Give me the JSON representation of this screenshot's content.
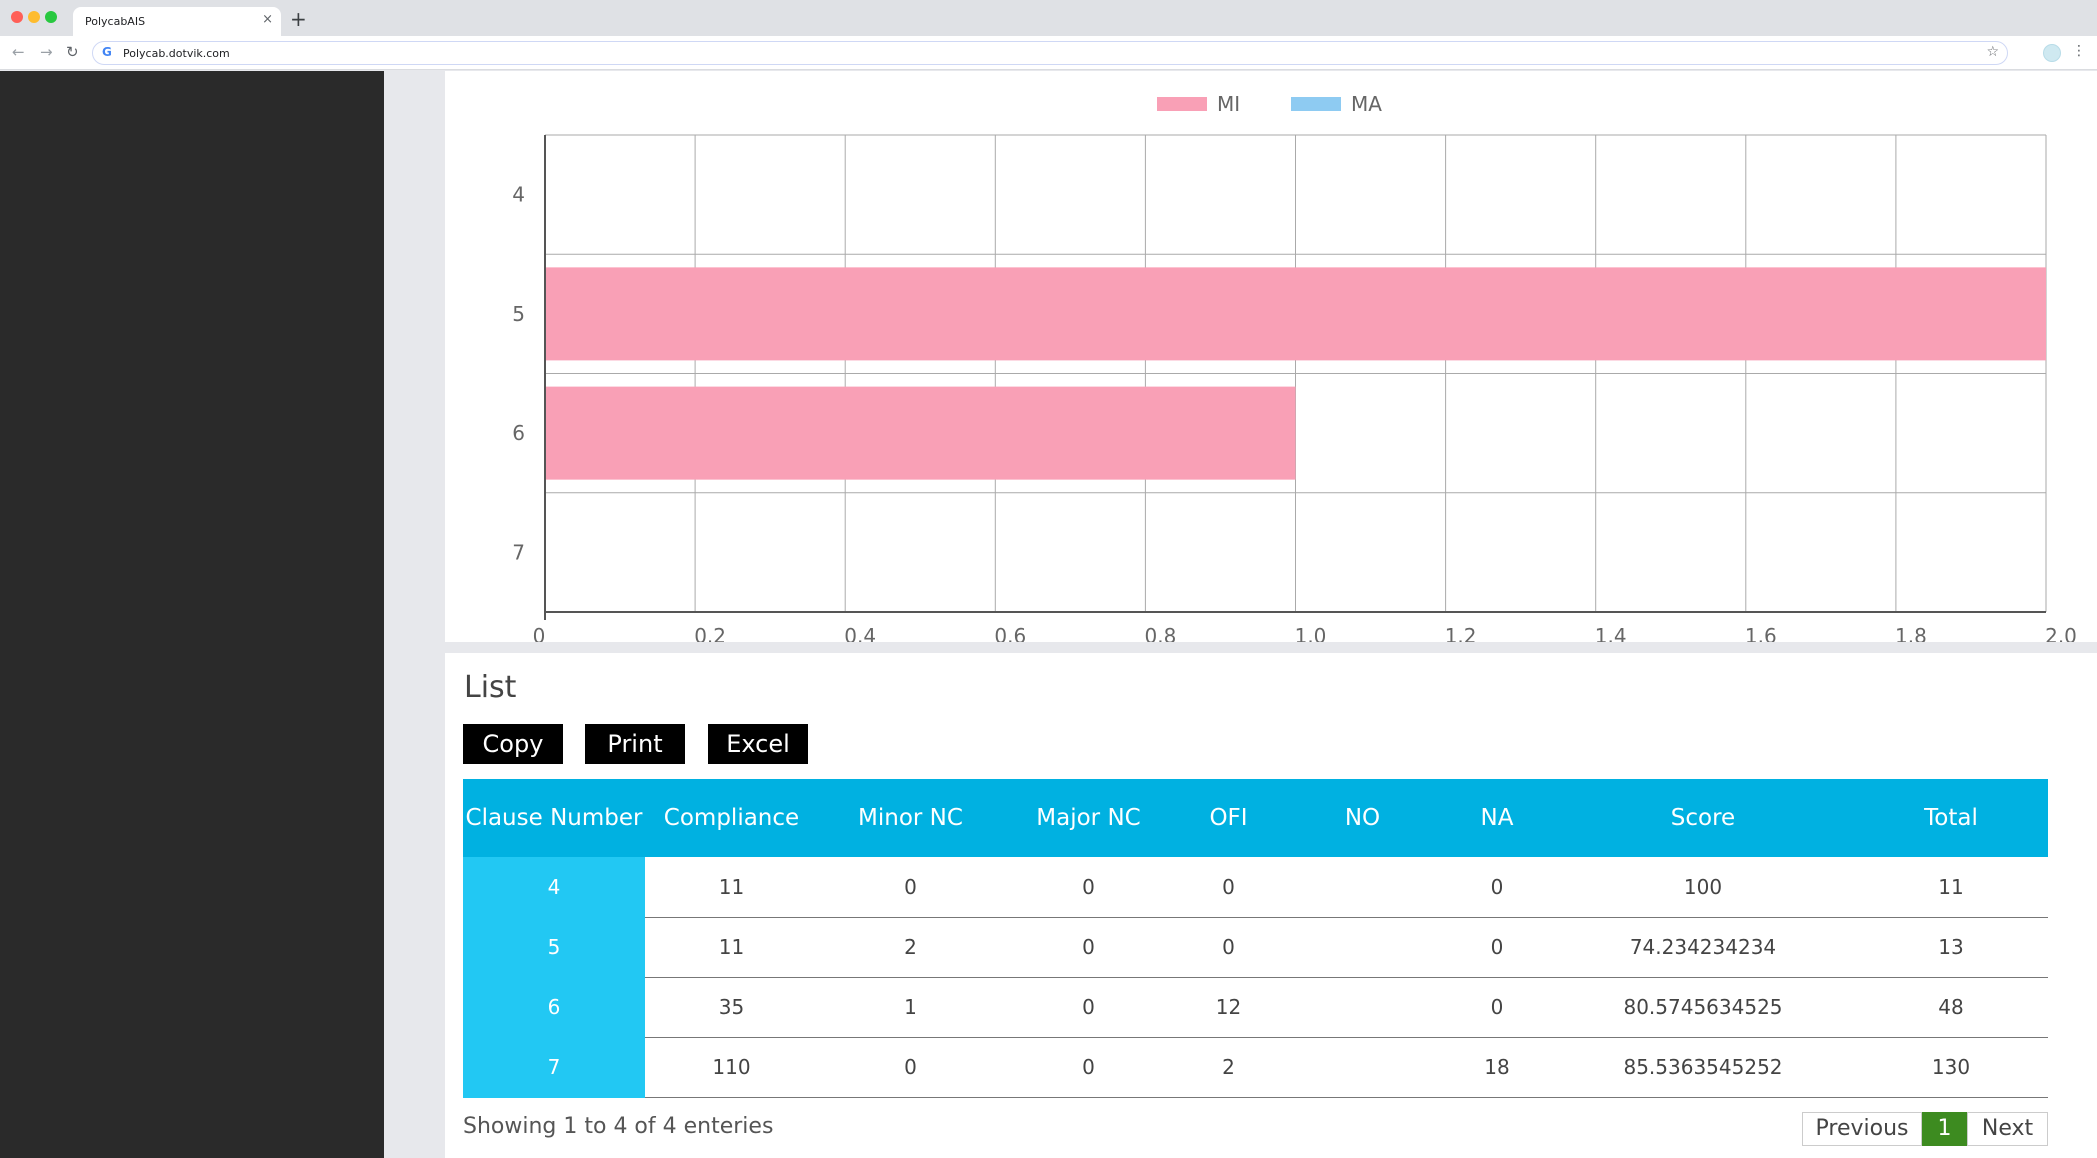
{
  "browser": {
    "tab_title": "PolycabAIS",
    "tab_close": "×",
    "new_tab": "+",
    "url": "Polycab.dotvik.com",
    "back": "←",
    "forward": "→",
    "reload": "↻",
    "star": "☆",
    "menu": "⋮",
    "google_g": "G"
  },
  "chart_data": {
    "type": "bar",
    "orientation": "horizontal",
    "categories": [
      "4",
      "5",
      "6",
      "7"
    ],
    "series": [
      {
        "name": "MI",
        "values": [
          0,
          2,
          1,
          0
        ],
        "color": "#f9a0b6"
      },
      {
        "name": "MA",
        "values": [
          0,
          0,
          0,
          0
        ],
        "color": "#8ecbf2"
      }
    ],
    "xlim": [
      0,
      2
    ],
    "x_ticks": [
      "0",
      "0.2",
      "0.4",
      "0.6",
      "0.8",
      "1.0",
      "1.2",
      "1.4",
      "1.6",
      "1.8",
      "2.0"
    ],
    "grid": true,
    "legend": "top-center"
  },
  "list": {
    "title": "List",
    "buttons": {
      "copy": "Copy",
      "print": "Print",
      "excel": "Excel"
    },
    "columns": [
      "Clause Number",
      "Compliance",
      "Minor NC",
      "Major NC",
      "OFI",
      "NO",
      "NA",
      "Score",
      "Total"
    ],
    "rows": [
      [
        "4",
        "11",
        "0",
        "0",
        "0",
        "",
        "0",
        "100",
        "11"
      ],
      [
        "5",
        "11",
        "2",
        "0",
        "0",
        "",
        "0",
        "74.234234234",
        "13"
      ],
      [
        "6",
        "35",
        "1",
        "0",
        "12",
        "",
        "0",
        "80.5745634525",
        "48"
      ],
      [
        "7",
        "110",
        "0",
        "0",
        "2",
        "",
        "18",
        "85.5363545252",
        "130"
      ]
    ],
    "showing_text": "Showing 1 to 4 of 4 enteries",
    "pagination": {
      "previous": "Previous",
      "current": "1",
      "next": "Next"
    }
  }
}
